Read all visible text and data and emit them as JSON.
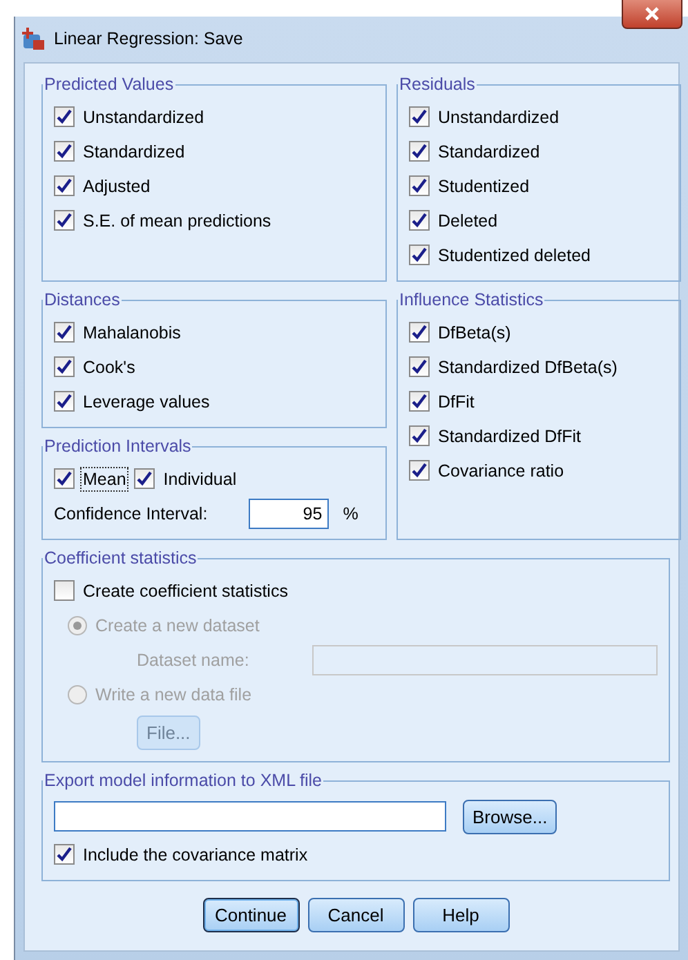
{
  "window": {
    "title": "Linear Regression: Save"
  },
  "predicted_values": {
    "title": "Predicted Values",
    "options": [
      {
        "label": "Unstandardized",
        "checked": true
      },
      {
        "label": "Standardized",
        "checked": true
      },
      {
        "label": "Adjusted",
        "checked": true
      },
      {
        "label": "S.E. of mean predictions",
        "checked": true
      }
    ]
  },
  "residuals": {
    "title": "Residuals",
    "options": [
      {
        "label": "Unstandardized",
        "checked": true
      },
      {
        "label": "Standardized",
        "checked": true
      },
      {
        "label": "Studentized",
        "checked": true
      },
      {
        "label": "Deleted",
        "checked": true
      },
      {
        "label": "Studentized deleted",
        "checked": true
      }
    ]
  },
  "distances": {
    "title": "Distances",
    "options": [
      {
        "label": "Mahalanobis",
        "checked": true
      },
      {
        "label": "Cook's",
        "checked": true
      },
      {
        "label": "Leverage values",
        "checked": true
      }
    ]
  },
  "influence_statistics": {
    "title": "Influence Statistics",
    "options": [
      {
        "label": "DfBeta(s)",
        "checked": true
      },
      {
        "label": "Standardized DfBeta(s)",
        "checked": true
      },
      {
        "label": "DfFit",
        "checked": true
      },
      {
        "label": "Standardized DfFit",
        "checked": true
      },
      {
        "label": "Covariance ratio",
        "checked": true
      }
    ]
  },
  "prediction_intervals": {
    "title": "Prediction Intervals",
    "options": [
      {
        "label": "Mean",
        "checked": true,
        "focused": true
      },
      {
        "label": "Individual",
        "checked": true,
        "focused": false
      }
    ],
    "confidence_label": "Confidence Interval:",
    "confidence_value": "95",
    "unit": "%"
  },
  "coefficient_statistics": {
    "title": "Coefficient statistics",
    "option": {
      "label": "Create coefficient statistics",
      "checked": false
    },
    "destinations": [
      {
        "label": "Create a new dataset",
        "selected": true
      },
      {
        "label": "Write a new data file",
        "selected": false
      }
    ],
    "dataset_name_label": "Dataset name:",
    "file_button": "File..."
  },
  "export": {
    "title": "Export model information to XML file",
    "browse_button": "Browse...",
    "include": {
      "label": "Include the covariance matrix",
      "checked": true
    }
  },
  "buttons": [
    {
      "label": "Continue",
      "default": true
    },
    {
      "label": "Cancel",
      "default": false
    },
    {
      "label": "Help",
      "default": false
    }
  ]
}
